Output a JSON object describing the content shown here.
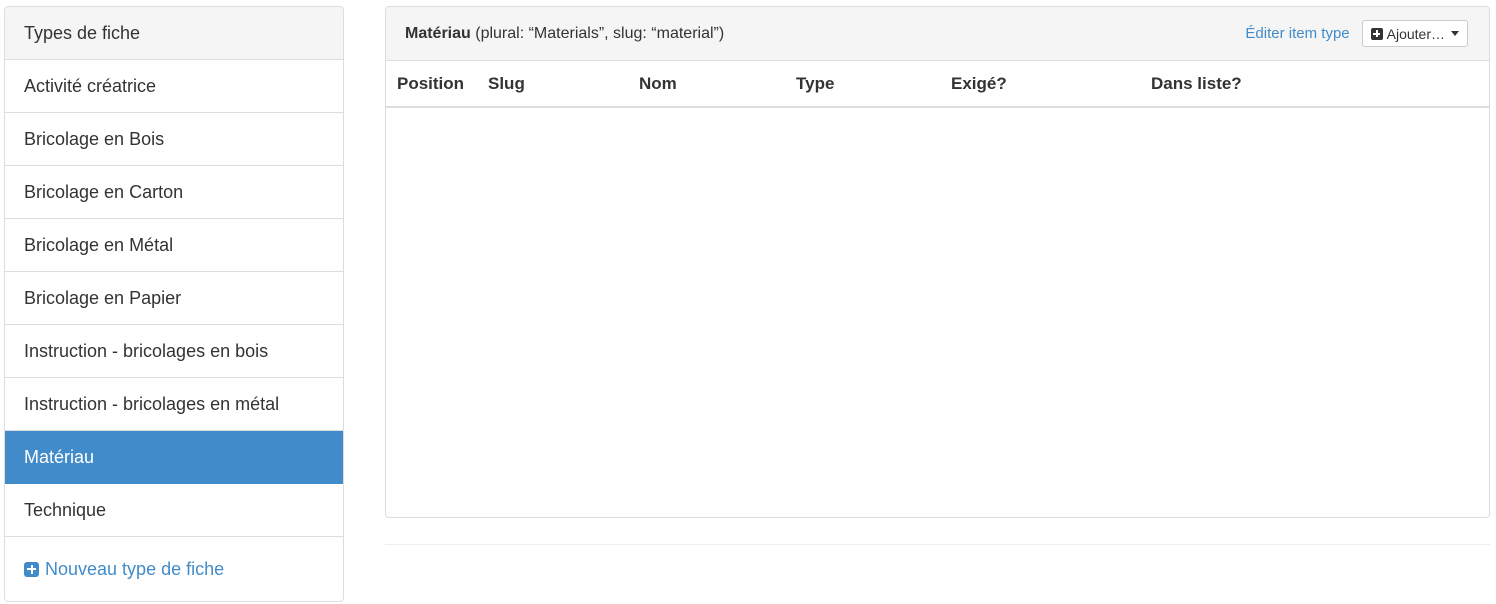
{
  "sidebar": {
    "header": "Types de fiche",
    "items": [
      {
        "label": "Activité créatrice",
        "active": false
      },
      {
        "label": "Bricolage en Bois",
        "active": false
      },
      {
        "label": "Bricolage en Carton",
        "active": false
      },
      {
        "label": "Bricolage en Métal",
        "active": false
      },
      {
        "label": "Bricolage en Papier",
        "active": false
      },
      {
        "label": "Instruction - bricolages en bois",
        "active": false
      },
      {
        "label": "Instruction - bricolages en métal",
        "active": false
      },
      {
        "label": "Matériau",
        "active": true
      },
      {
        "label": "Technique",
        "active": false
      }
    ],
    "new_type_label": "Nouveau type de fiche"
  },
  "panel": {
    "title_name": "Matériau",
    "title_details": " (plural: “Materials”, slug: “material”)",
    "edit_link": "Éditer item type",
    "add_button": "Ajouter…",
    "columns": [
      "Position",
      "Slug",
      "Nom",
      "Type",
      "Exigé?",
      "Dans liste?"
    ],
    "rows": []
  },
  "colors": {
    "accent": "#428bca",
    "border": "#dddddd",
    "header_bg": "#f5f5f5"
  }
}
